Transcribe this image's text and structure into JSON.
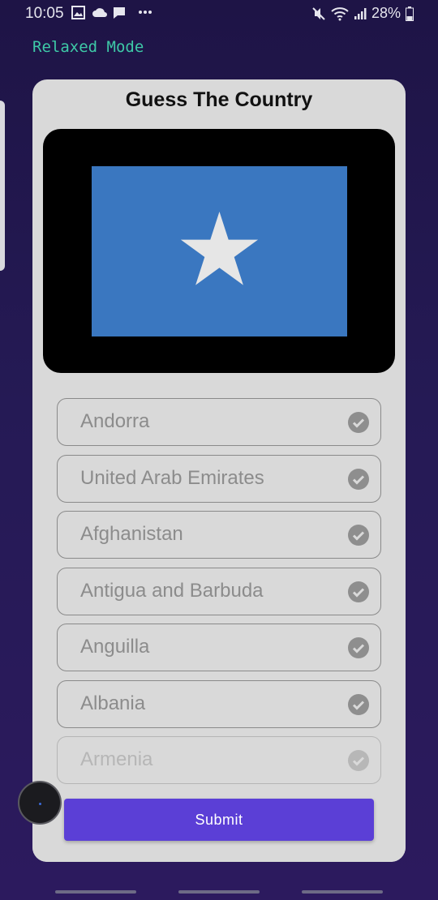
{
  "status_bar": {
    "time": "10:05",
    "battery": "28%",
    "icons": [
      "image-icon",
      "cloud-icon",
      "chat-icon",
      "more-icon",
      "mute-icon",
      "wifi-icon",
      "signal-icon",
      "battery-icon"
    ]
  },
  "mode_label": "Relaxed Mode",
  "card": {
    "title": "Guess The Country",
    "flag": {
      "background": "#3a77c0",
      "star": "#e6e6e6"
    },
    "options": [
      {
        "label": "Andorra"
      },
      {
        "label": "United Arab Emirates"
      },
      {
        "label": "Afghanistan"
      },
      {
        "label": "Antigua and Barbuda"
      },
      {
        "label": "Anguilla"
      },
      {
        "label": "Albania"
      },
      {
        "label": "Armenia"
      }
    ],
    "submit_label": "Submit"
  },
  "colors": {
    "accent": "#5b3fd6",
    "mode_text": "#3ec9a7",
    "card": "#d9d9d9"
  }
}
